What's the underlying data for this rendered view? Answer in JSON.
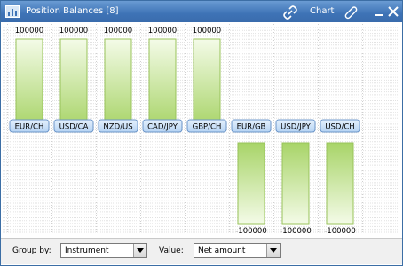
{
  "window": {
    "title": "Position Balances [8]",
    "chart_label": "Chart",
    "accent_color": "#3e73b6"
  },
  "toolbar": {
    "group_by_label": "Group by:",
    "group_by_value": "Instrument",
    "value_label": "Value:",
    "value_value": "Net amount"
  },
  "chart_data": {
    "type": "bar",
    "categories": [
      "EUR/CH",
      "USD/CA",
      "NZD/US",
      "CAD/JPY",
      "GBP/CH",
      "EUR/GB",
      "USD/JPY",
      "USD/CH"
    ],
    "values": [
      100000,
      100000,
      100000,
      100000,
      100000,
      -100000,
      -100000,
      -100000
    ],
    "data_labels": [
      "100000",
      "100000",
      "100000",
      "100000",
      "100000",
      "-100000",
      "-100000",
      "-100000"
    ],
    "ylim": [
      -100000,
      100000
    ],
    "grid": true,
    "bar_color": "#a8d468"
  }
}
